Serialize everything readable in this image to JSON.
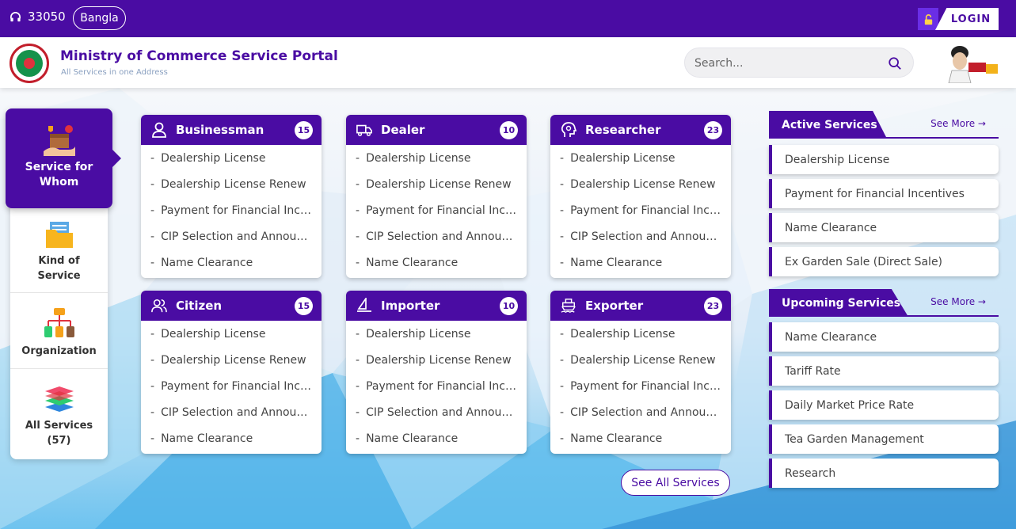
{
  "topbar": {
    "hotline": "33050",
    "language_button": "Bangla",
    "login_label": "LOGIN"
  },
  "header": {
    "title": "Ministry of Commerce Service Portal",
    "subtitle": "All Services in one Address",
    "search_placeholder": "Search..."
  },
  "left_tabs": {
    "active": {
      "label_line1": "Service for",
      "label_line2": "Whom",
      "icon": "service-box-icon"
    },
    "kind": {
      "label_line1": "Kind of",
      "label_line2": "Service",
      "icon": "folder-icon"
    },
    "organization": {
      "label": "Organization",
      "icon": "org-chart-icon"
    },
    "all": {
      "label_line1": "All Services",
      "label_line2": "(57)",
      "icon": "layers-icon"
    }
  },
  "cards": [
    {
      "title": "Businessman",
      "count": "15",
      "icon": "person-icon",
      "items": [
        "Dealership License",
        "Dealership License Renew",
        "Payment for Financial Incentives",
        "CIP Selection and Announcement",
        "Name Clearance"
      ]
    },
    {
      "title": "Dealer",
      "count": "10",
      "icon": "truck-icon",
      "items": [
        "Dealership License",
        "Dealership License Renew",
        "Payment for Financial Incentives",
        "CIP Selection and Announcement",
        "Name Clearance"
      ]
    },
    {
      "title": "Researcher",
      "count": "23",
      "icon": "head-bulb-icon",
      "items": [
        "Dealership License",
        "Dealership License Renew",
        "Payment for Financial Incentives",
        "CIP Selection and Announcement",
        "Name Clearance"
      ]
    },
    {
      "title": "Citizen",
      "count": "15",
      "icon": "people-icon",
      "items": [
        "Dealership License",
        "Dealership License Renew",
        "Payment for Financial Incentives",
        "CIP Selection and Announcement",
        "Name Clearance"
      ]
    },
    {
      "title": "Importer",
      "count": "10",
      "icon": "sailboat-icon",
      "items": [
        "Dealership License",
        "Dealership License Renew",
        "Payment for Financial Incentives",
        "CIP Selection and Announcement",
        "Name Clearance"
      ]
    },
    {
      "title": "Exporter",
      "count": "23",
      "icon": "ship-icon",
      "items": [
        "Dealership License",
        "Dealership License Renew",
        "Payment for Financial Incentives",
        "CIP Selection and Announcement",
        "Name Clearance"
      ]
    }
  ],
  "see_all_button": "See All Services",
  "active_services": {
    "title": "Active Services",
    "see_more": "See More →",
    "items": [
      "Dealership License",
      "Payment for Financial Incentives",
      "Name Clearance",
      "Ex Garden Sale (Direct Sale)"
    ]
  },
  "upcoming_services": {
    "title": "Upcoming Services",
    "see_more": "See More →",
    "items": [
      "Name Clearance",
      "Tariff Rate",
      "Daily Market Price Rate",
      "Tea Garden Management",
      "Research"
    ]
  },
  "colors": {
    "brand": "#4a0ca3",
    "accent_red": "#c21e2b",
    "accent_green": "#15924b"
  }
}
